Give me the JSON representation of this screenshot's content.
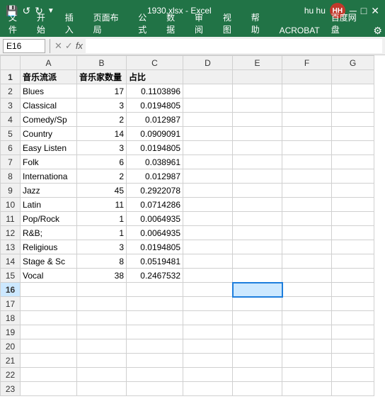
{
  "titleBar": {
    "filename": "1930.xlsx - Excel",
    "user": "hu hu",
    "userInitials": "HH",
    "undoIcon": "↺",
    "redoIcon": "↻",
    "saveIcon": "💾",
    "customizeIcon": "▼",
    "windowMinIcon": "─",
    "windowMaxIcon": "□",
    "windowCloseIcon": "✕"
  },
  "ribbonTabs": [
    "文件",
    "开始",
    "插入",
    "页面布局",
    "公式",
    "数据",
    "审阅",
    "视图",
    "帮助",
    "ACROBAT",
    "百度网盘"
  ],
  "cellRef": "E16",
  "formulaContent": "",
  "columns": [
    "A",
    "B",
    "C",
    "D",
    "E",
    "F",
    "G"
  ],
  "headerRow": {
    "A": "音乐流派",
    "B": "音乐家数量",
    "C": "占比"
  },
  "rows": [
    {
      "num": 2,
      "A": "Blues",
      "B": "17",
      "C": "0.1103896"
    },
    {
      "num": 3,
      "A": "Classical",
      "B": "3",
      "C": "0.0194805"
    },
    {
      "num": 4,
      "A": "Comedy/Sp",
      "B": "2",
      "C": "0.012987"
    },
    {
      "num": 5,
      "A": "Country",
      "B": "14",
      "C": "0.0909091"
    },
    {
      "num": 6,
      "A": "Easy Listen",
      "B": "3",
      "C": "0.0194805"
    },
    {
      "num": 7,
      "A": "Folk",
      "B": "6",
      "C": "0.038961"
    },
    {
      "num": 8,
      "A": "Internationa",
      "B": "2",
      "C": "0.012987"
    },
    {
      "num": 9,
      "A": "Jazz",
      "B": "45",
      "C": "0.2922078"
    },
    {
      "num": 10,
      "A": "Latin",
      "B": "11",
      "C": "0.0714286"
    },
    {
      "num": 11,
      "A": "Pop/Rock",
      "B": "1",
      "C": "0.0064935"
    },
    {
      "num": 12,
      "A": "R&B;",
      "B": "1",
      "C": "0.0064935"
    },
    {
      "num": 13,
      "A": "Religious",
      "B": "3",
      "C": "0.0194805"
    },
    {
      "num": 14,
      "A": "Stage & Sc",
      "B": "8",
      "C": "0.0519481"
    },
    {
      "num": 15,
      "A": "Vocal",
      "B": "38",
      "C": "0.2467532"
    }
  ],
  "emptyRows": [
    16,
    17,
    18,
    19,
    20,
    21,
    22,
    23
  ],
  "activeCell": "E16"
}
